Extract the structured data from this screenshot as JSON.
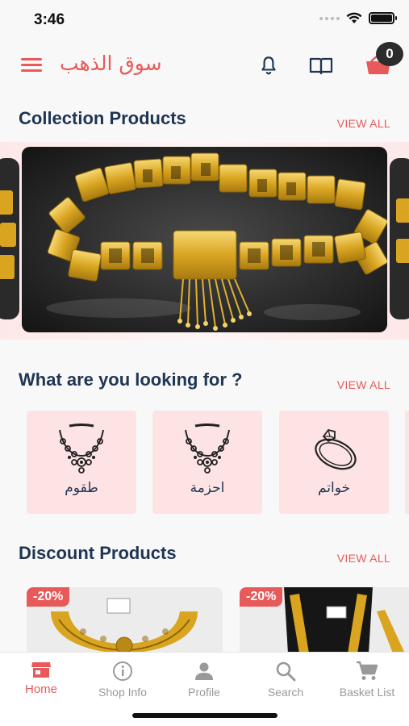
{
  "status_bar": {
    "time": "3:46"
  },
  "header": {
    "app_title": "سوق الذهب",
    "cart_count": "0"
  },
  "collection": {
    "title": "Collection Products",
    "view_all": "VIEW ALL"
  },
  "categories": {
    "title": "What are you looking for ?",
    "view_all": "VIEW ALL",
    "items": [
      {
        "label": "طقوم",
        "icon": "necklace-icon"
      },
      {
        "label": "احزمة",
        "icon": "necklace-icon"
      },
      {
        "label": "خواتم",
        "icon": "ring-icon"
      }
    ]
  },
  "discount": {
    "title": "Discount Products",
    "view_all": "VIEW ALL",
    "products": [
      {
        "badge": "-20%"
      },
      {
        "badge": "-20%"
      }
    ]
  },
  "bottom_nav": {
    "items": [
      {
        "label": "Home",
        "icon": "store-icon",
        "active": true
      },
      {
        "label": "Shop Info",
        "icon": "info-icon"
      },
      {
        "label": "Profile",
        "icon": "person-icon"
      },
      {
        "label": "Search",
        "icon": "search-icon"
      },
      {
        "label": "Basket List",
        "icon": "cart-icon"
      }
    ]
  },
  "colors": {
    "accent": "#e85a5a",
    "navy": "#1f3553",
    "category_bg": "#fde3e3",
    "gold": "#d9a521"
  }
}
